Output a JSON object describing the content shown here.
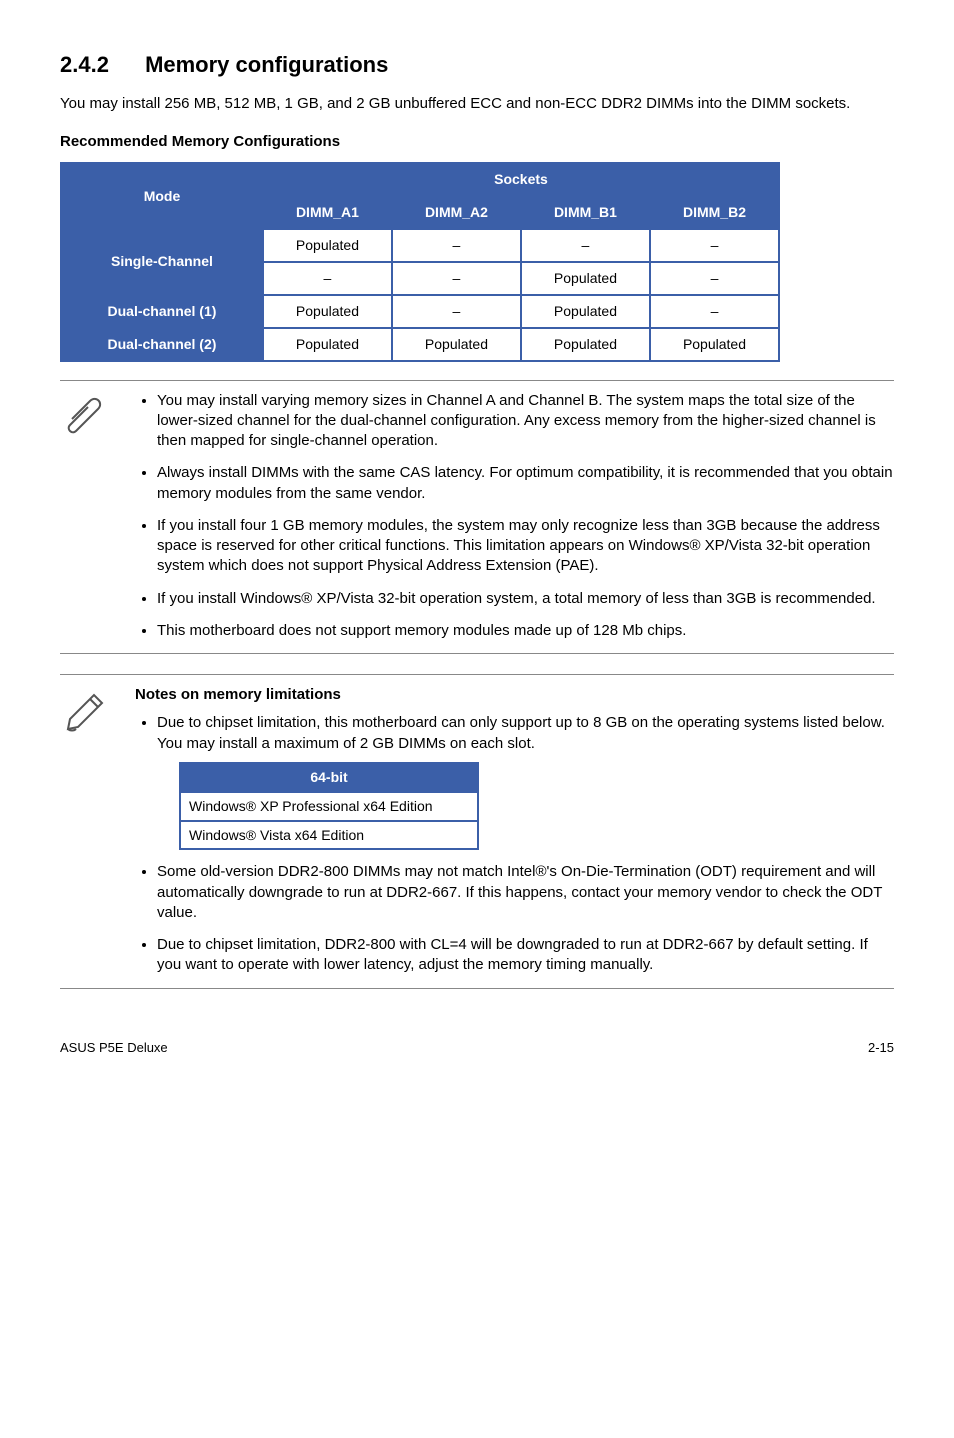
{
  "heading": {
    "number": "2.4.2",
    "title": "Memory configurations"
  },
  "intro": "You may install 256 MB, 512 MB, 1 GB, and 2 GB unbuffered ECC and non-ECC DDR2 DIMMs into the DIMM sockets.",
  "subhead": "Recommended Memory Configurations",
  "table": {
    "mode_label": "Mode",
    "sockets_label": "Sockets",
    "cols": [
      "DIMM_A1",
      "DIMM_A2",
      "DIMM_B1",
      "DIMM_B2"
    ],
    "rows": [
      {
        "label": "Single-Channel",
        "rowspan": 2,
        "cells": [
          "Populated",
          "–",
          "–",
          "–"
        ]
      },
      {
        "label": "",
        "cells": [
          "–",
          "–",
          "Populated",
          "–"
        ]
      },
      {
        "label": "Dual-channel (1)",
        "cells": [
          "Populated",
          "–",
          "Populated",
          "–"
        ]
      },
      {
        "label": "Dual-channel (2)",
        "cells": [
          "Populated",
          "Populated",
          "Populated",
          "Populated"
        ]
      }
    ]
  },
  "notes1": [
    "You may install varying memory sizes in Channel A and Channel B. The system maps the total size of the lower-sized channel for the dual-channel configuration. Any excess memory from the higher-sized channel is then mapped for single-channel operation.",
    "Always install DIMMs with the same CAS latency. For optimum compatibility, it is recommended that you obtain memory modules from the same vendor.",
    "If you install four 1 GB memory modules, the system may only recognize less than 3GB because the address space is reserved for other critical functions. This limitation appears on Windows® XP/Vista 32-bit operation system which does not support Physical Address Extension (PAE).",
    "If you install Windows® XP/Vista 32-bit operation system, a total memory of less than 3GB is recommended.",
    "This motherboard does not support memory modules made up of 128 Mb chips."
  ],
  "notes2": {
    "title": "Notes on memory limitations",
    "lead": "Due to chipset limitation, this motherboard can only support up to 8 GB on the operating systems listed below. You may install a maximum of 2 GB DIMMs on each slot.",
    "os_header": "64-bit",
    "os_rows": [
      "Windows® XP Professional x64 Edition",
      "Windows® Vista x64 Edition"
    ],
    "rest": [
      "Some old-version DDR2-800 DIMMs may not match Intel®'s On-Die-Termination (ODT) requirement and will automatically downgrade to run at DDR2-667. If this happens, contact your memory vendor to check the ODT value.",
      "Due to chipset limitation, DDR2-800 with CL=4 will be downgraded to run at DDR2-667 by default setting. If you want to operate with lower latency, adjust the memory timing manually."
    ]
  },
  "footer": {
    "left": "ASUS P5E Deluxe",
    "right": "2-15"
  }
}
